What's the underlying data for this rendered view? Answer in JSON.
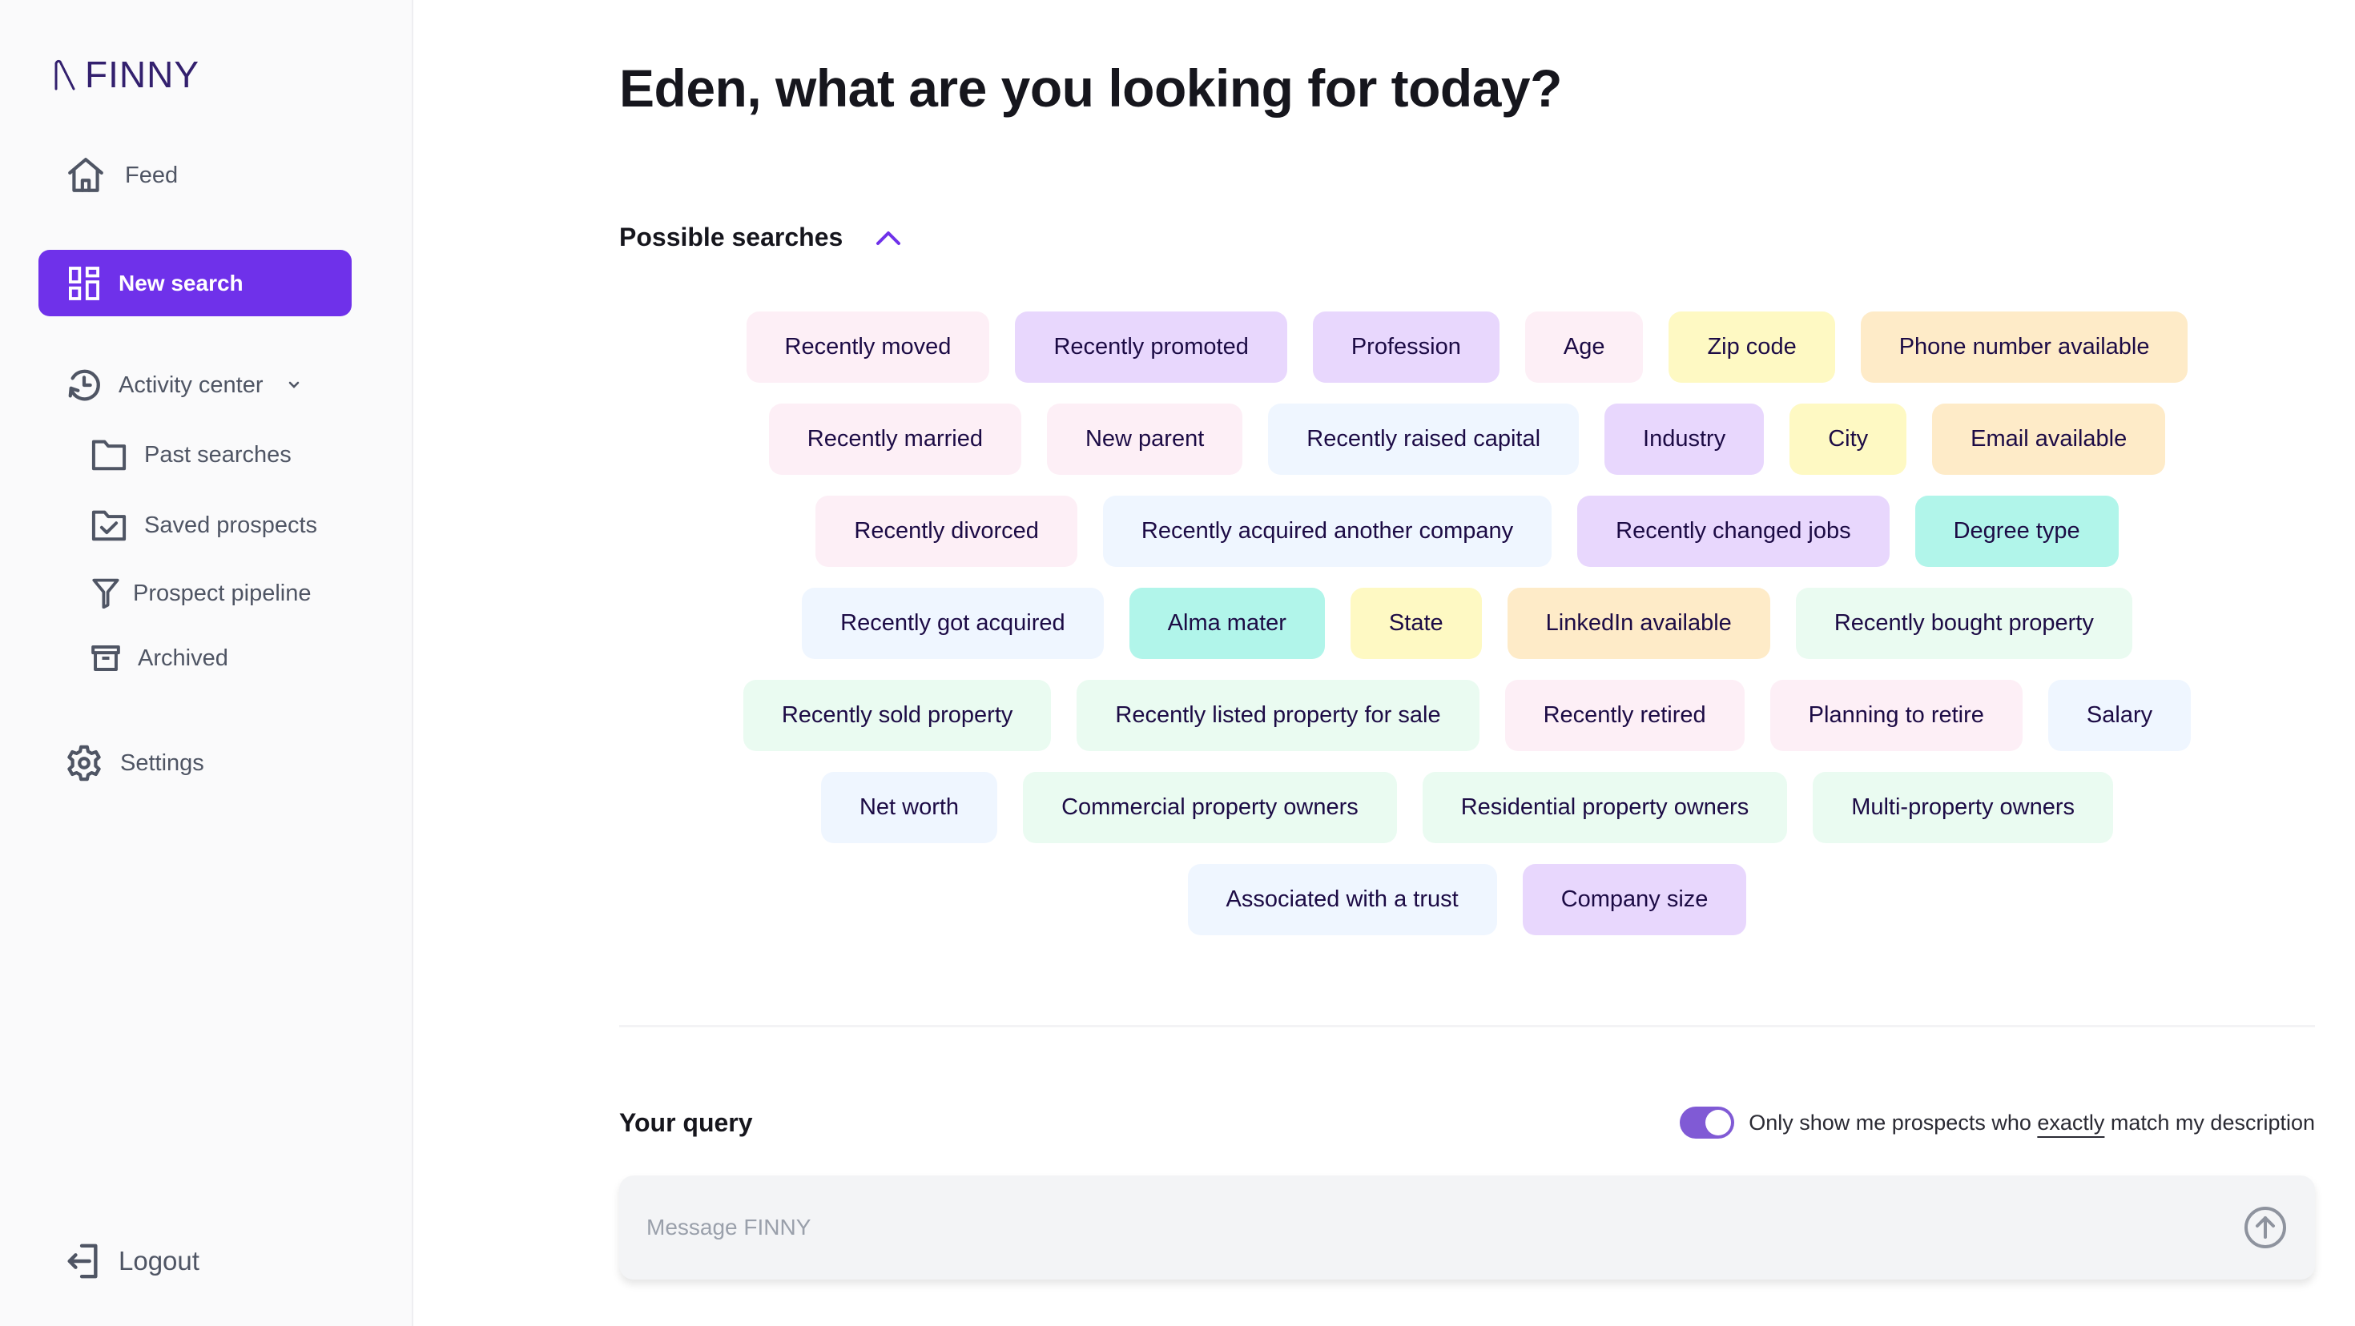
{
  "app": {
    "logo_text": "FINNY",
    "brand_color": "#6f31ea"
  },
  "sidebar": {
    "feed": {
      "label": "Feed",
      "icon": "home-icon"
    },
    "new_search": {
      "label": "New search",
      "icon": "dashboard-icon"
    },
    "activity_center": {
      "label": "Activity center",
      "icon": "history-icon",
      "expanded": true
    },
    "sub_items": [
      {
        "label": "Past searches",
        "icon": "folder-icon"
      },
      {
        "label": "Saved prospects",
        "icon": "folder-check-icon"
      },
      {
        "label": "Prospect pipeline",
        "icon": "funnel-icon"
      },
      {
        "label": "Archived",
        "icon": "archive-icon"
      }
    ],
    "settings": {
      "label": "Settings",
      "icon": "gear-icon"
    },
    "logout": {
      "label": "Logout",
      "icon": "logout-icon"
    }
  },
  "main": {
    "title": "Eden, what are you looking for today?",
    "possible_searches": {
      "heading": "Possible searches",
      "chips": [
        {
          "label": "Recently moved",
          "color": "pink"
        },
        {
          "label": "Recently promoted",
          "color": "purple"
        },
        {
          "label": "Profession",
          "color": "purple"
        },
        {
          "label": "Age",
          "color": "pink"
        },
        {
          "label": "Zip code",
          "color": "yellow"
        },
        {
          "label": "Phone number available",
          "color": "orange"
        },
        {
          "label": "Recently married",
          "color": "pink"
        },
        {
          "label": "New parent",
          "color": "pink"
        },
        {
          "label": "Recently raised capital",
          "color": "blue"
        },
        {
          "label": "Industry",
          "color": "purple"
        },
        {
          "label": "City",
          "color": "yellow"
        },
        {
          "label": "Email available",
          "color": "orange"
        },
        {
          "label": "Recently divorced",
          "color": "pink"
        },
        {
          "label": "Recently acquired another company",
          "color": "blue"
        },
        {
          "label": "Recently changed jobs",
          "color": "purple"
        },
        {
          "label": "Degree type",
          "color": "teal"
        },
        {
          "label": "Recently got acquired",
          "color": "blue"
        },
        {
          "label": "Alma mater",
          "color": "teal"
        },
        {
          "label": "State",
          "color": "yellow"
        },
        {
          "label": "LinkedIn available",
          "color": "orange"
        },
        {
          "label": "Recently bought property",
          "color": "green"
        },
        {
          "label": "Recently sold property",
          "color": "green"
        },
        {
          "label": "Recently listed property for sale",
          "color": "green"
        },
        {
          "label": "Recently retired",
          "color": "pink"
        },
        {
          "label": "Planning to retire",
          "color": "pink"
        },
        {
          "label": "Salary",
          "color": "blue"
        },
        {
          "label": "Net worth",
          "color": "blue"
        },
        {
          "label": "Commercial property owners",
          "color": "green"
        },
        {
          "label": "Residential property owners",
          "color": "green"
        },
        {
          "label": "Multi-property owners",
          "color": "green"
        },
        {
          "label": "Associated with a trust",
          "color": "blue"
        },
        {
          "label": "Company size",
          "color": "purple"
        }
      ],
      "rows": [
        6,
        6,
        4,
        5,
        5,
        4,
        2
      ]
    },
    "query": {
      "heading": "Your query",
      "toggle": {
        "on": true,
        "label_before": "Only show me prospects who ",
        "label_emphasis": "exactly",
        "label_after": " match my description"
      },
      "input": {
        "value": "",
        "placeholder": "Message FINNY"
      },
      "send_icon": "arrow-up-circle-icon"
    }
  }
}
